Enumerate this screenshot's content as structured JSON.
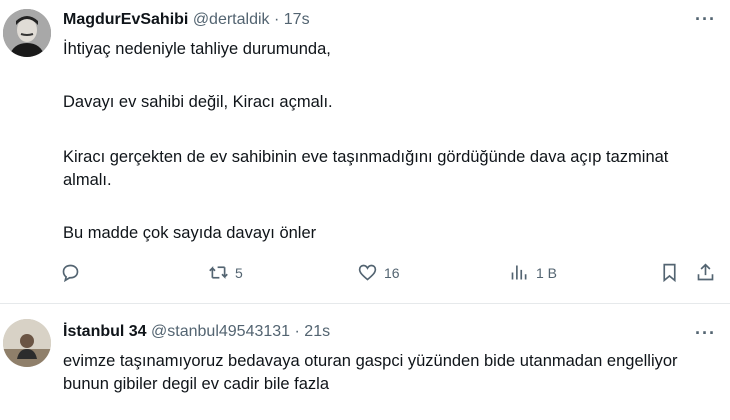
{
  "tweets": [
    {
      "name": "MagdurEvSahibi",
      "handle": "@dertaldik",
      "separator": "·",
      "time": "17s",
      "paragraphs": [
        "İhtiyaç nedeniyle tahliye durumunda,",
        "Davayı ev sahibi değil, Kiracı açmalı.",
        "Kiracı gerçekten de ev sahibinin eve taşınmadığını gördüğünde dava açıp tazminat almalı.",
        "Bu madde çok sayıda davayı önler"
      ],
      "actions": {
        "replies": "",
        "retweets": "5",
        "likes": "16",
        "views": "1 B"
      }
    },
    {
      "name": "İstanbul 34",
      "handle": "@stanbul49543131",
      "separator": "·",
      "time": "21s",
      "paragraphs": [
        "evimze taşınamıyoruz bedavaya oturan gaspci yüzünden bide utanmadan engelliyor bunun gibiler degil ev cadir bile fazla"
      ]
    }
  ],
  "icons": {
    "more": "more-icon",
    "reply": "reply-icon",
    "retweet": "retweet-icon",
    "like": "heart-icon",
    "views": "views-icon",
    "bookmark": "bookmark-icon",
    "share": "share-icon"
  },
  "colors": {
    "text": "#0f1419",
    "secondary": "#536471",
    "divider": "#e6e9eb"
  }
}
